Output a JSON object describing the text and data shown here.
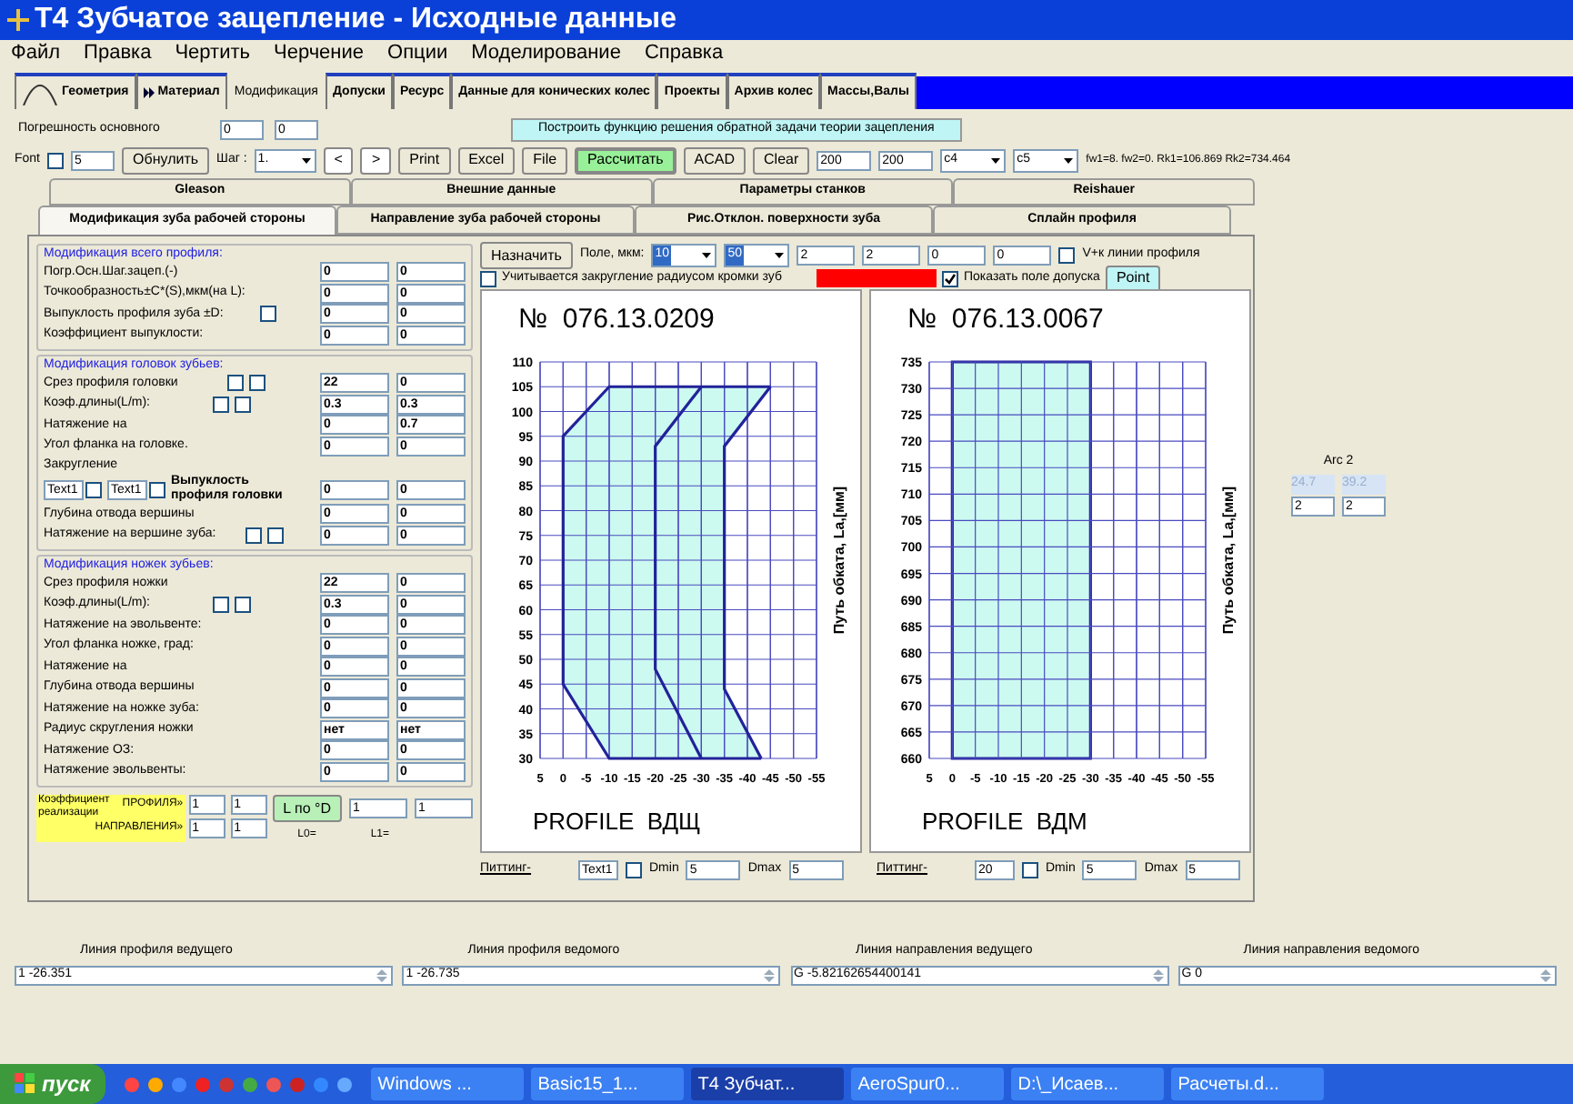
{
  "window": {
    "title": "T4 Зубчатое зацепление - Исходные данные"
  },
  "menu": [
    "Файл",
    "Правка",
    "Чертить",
    "Черчение",
    "Опции",
    "Моделирование",
    "Справка"
  ],
  "top_tabs": [
    {
      "label": "Геометрия",
      "selected": false,
      "kind": "arch"
    },
    {
      "label": "Материал",
      "selected": false,
      "kind": "arrow"
    },
    {
      "label": "Модификация",
      "selected": true,
      "kind": "plain"
    },
    {
      "label": "Допуски",
      "selected": false,
      "kind": "plain"
    },
    {
      "label": "Ресурс",
      "selected": false,
      "kind": "plain"
    },
    {
      "label": "Данные для конических колес",
      "selected": false,
      "kind": "plain"
    },
    {
      "label": "Проекты",
      "selected": false,
      "kind": "plain"
    },
    {
      "label": "Архив колес",
      "selected": false,
      "kind": "plain"
    },
    {
      "label": "Массы,Валы",
      "selected": false,
      "kind": "plain"
    }
  ],
  "toolbar": {
    "error_label": "Погрешность основного",
    "error_values": [
      "0",
      "0"
    ],
    "solve_button": "Построить функцию решения обратной задачи теории зацепления",
    "font_label": "Font",
    "font_checked": false,
    "font_value": "5",
    "reset_button": "Обнулить",
    "step_label": "Шаг :",
    "step_value": "1.",
    "prev_button": "<",
    "next_button": ">",
    "buttons": [
      {
        "label": "Print",
        "kind": "plain"
      },
      {
        "label": "Excel",
        "kind": "plain"
      },
      {
        "label": "File",
        "kind": "plain"
      },
      {
        "label": "Рассчитать",
        "kind": "primary"
      },
      {
        "label": "ACAD",
        "kind": "plain"
      },
      {
        "label": "Clear",
        "kind": "plain"
      }
    ],
    "values": [
      "200",
      "200"
    ],
    "selects": [
      "c4",
      "c5"
    ],
    "result": "fw1=8. fw2=0. Rk1=106.869 Rk2=734.464"
  },
  "tabs_back": [
    {
      "label": "Gleason",
      "selected": false
    },
    {
      "label": "Внешние данные",
      "selected": false
    },
    {
      "label": "Параметры станков",
      "selected": false
    },
    {
      "label": "Reishauer",
      "selected": false
    }
  ],
  "tabs_front": [
    {
      "label": "Модификация зуба рабочей стороны",
      "selected": true
    },
    {
      "label": "Направление зуба рабочей стороны",
      "selected": false
    },
    {
      "label": "Рис.Отклон. поверхности зуба",
      "selected": false
    },
    {
      "label": "Сплайн профиля",
      "selected": false
    }
  ],
  "groups": [
    {
      "title": "Модификация всего профиля:",
      "rows": [
        {
          "kind": "field",
          "label": "Погр.Осн.Шаг.зацеп.(-)",
          "values": [
            "0",
            "0"
          ]
        },
        {
          "kind": "field",
          "label": "Точкообразность±C*(S),мкм(на L):",
          "values": [
            "0",
            "0"
          ]
        },
        {
          "kind": "field",
          "label": "Выпуклость профиля зуба ±D:",
          "checks": [
            false
          ],
          "values": [
            "0",
            "0"
          ]
        },
        {
          "kind": "field",
          "label": "Коэффициент выпуклости:",
          "values": [
            "0",
            "0"
          ]
        }
      ]
    },
    {
      "title": "Модификация головок зубьев:",
      "rows": [
        {
          "kind": "field",
          "label": "Срез профиля головки",
          "checks": [
            false,
            false
          ],
          "values": [
            "22",
            "0"
          ]
        },
        {
          "kind": "field",
          "label": "Коэф.длины(L/m):",
          "checks": [
            false,
            false
          ],
          "values": [
            "0.3",
            "0.3"
          ]
        },
        {
          "kind": "field",
          "label": "Натяжение на",
          "values": [
            "0",
            "0.7"
          ]
        },
        {
          "kind": "field",
          "label": "Угол фланка на головке.",
          "values": [
            "0",
            "0"
          ]
        },
        {
          "kind": "rounding",
          "label": "Закругление",
          "texts": [
            {
              "value": "Text1",
              "checked": false
            },
            {
              "value": "Text1",
              "checked": false
            }
          ],
          "bold_label": "Выпуклость профиля головки",
          "values": [
            "0",
            "0"
          ]
        },
        {
          "kind": "field",
          "label": "Глубина отвода вершины",
          "values": [
            "0",
            "0"
          ]
        },
        {
          "kind": "field",
          "label": "Натяжение на вершине зуба:",
          "checks": [
            false,
            false
          ],
          "values": [
            "0",
            "0"
          ]
        }
      ]
    },
    {
      "title": "Модификация ножек зубьев:",
      "rows": [
        {
          "kind": "field",
          "label": "Срез профиля ножки",
          "values": [
            "22",
            "0"
          ]
        },
        {
          "kind": "field",
          "label": "Коэф.длины(L/m):",
          "checks": [
            false,
            false
          ],
          "values": [
            "0.3",
            "0"
          ]
        },
        {
          "kind": "field",
          "label": "Натяжение на эвольвенте:",
          "values": [
            "0",
            "0"
          ]
        },
        {
          "kind": "field",
          "label": "Угол фланка ножке, град:",
          "values": [
            "0",
            "0"
          ]
        },
        {
          "kind": "field",
          "label": "Натяжение на",
          "values": [
            "0",
            "0"
          ]
        },
        {
          "kind": "field",
          "label": "Глубина отвода вершины",
          "values": [
            "0",
            "0"
          ]
        },
        {
          "kind": "field",
          "label": "Натяжение на ножке зуба:",
          "values": [
            "0",
            "0"
          ]
        },
        {
          "kind": "field",
          "label": "Радиус скругления ножки",
          "values": [
            "нет",
            "нет"
          ]
        },
        {
          "kind": "field",
          "label": "Натяжение ОЗ:",
          "values": [
            "0",
            "0"
          ]
        },
        {
          "kind": "field",
          "label": "Натяжение эвольвенты:",
          "values": [
            "0",
            "0"
          ]
        }
      ]
    }
  ],
  "coefficient": {
    "title": "Коэффициент реализации",
    "rows": [
      {
        "label": "ПРОФИЛЯ»",
        "values": [
          "1",
          "1"
        ]
      },
      {
        "label": "НАПРАВЛЕНИЯ»",
        "values": [
          "1",
          "1"
        ]
      }
    ],
    "button": "L по °D",
    "l_values": [
      "1",
      "1"
    ],
    "l_labels": [
      "L0=",
      "L1="
    ]
  },
  "chart_controls": {
    "assign_button": "Назначить",
    "field_label": "Поле, мкм:",
    "field_selects": [
      "10",
      "50"
    ],
    "values": [
      "2",
      "2",
      "0",
      "0"
    ],
    "vplus": {
      "label": "V+к линии профиля",
      "checked": false
    },
    "rounding_check": {
      "label": "Учитывается закругление радиусом кромки зуб",
      "checked": false
    },
    "tolerance": {
      "label": "Показать поле допуска",
      "checked": true
    },
    "point_button": "Point"
  },
  "charts": [
    {
      "chart_data": {
        "type": "line",
        "title": "№  076.13.0209",
        "grid": true,
        "xlabel": "PROFILE  ВДЩ",
        "ylabel": "Путь обката, La,[мм]",
        "xlim": [
          5,
          -55
        ],
        "ylim": [
          30,
          110
        ],
        "xticks": [
          5,
          0,
          -5,
          -10,
          -15,
          -20,
          -25,
          -30,
          -35,
          -40,
          -45,
          -50,
          -55
        ],
        "yticks": [
          30,
          35,
          40,
          45,
          50,
          55,
          60,
          65,
          70,
          75,
          80,
          85,
          90,
          95,
          100,
          105,
          110
        ],
        "series": [
          {
            "color": "#22229a",
            "x": [
              -45,
              -10,
              0,
              0,
              -10,
              -43
            ],
            "values": [
              105,
              105,
              95,
              45,
              30,
              30
            ]
          },
          {
            "color": "#22229a",
            "x": [
              -45,
              -35,
              -35,
              -43
            ],
            "values": [
              105,
              93,
              44,
              30
            ]
          },
          {
            "color": "#22229a",
            "x": [
              -30,
              -20,
              -20,
              -30
            ],
            "values": [
              105,
              93,
              48,
              30
            ]
          }
        ]
      },
      "pitting": {
        "label": "Питтинг-",
        "value": "Text1",
        "checked": false,
        "dmin_label": "Dmin",
        "dmin": "5",
        "dmax_label": "Dmax",
        "dmax": "5"
      }
    },
    {
      "chart_data": {
        "type": "area",
        "title": "№  076.13.0067",
        "grid": true,
        "xlabel": "PROFILE  ВДМ",
        "ylabel": "Путь обката, La,[мм]",
        "xlim": [
          5,
          -55
        ],
        "ylim": [
          660,
          735
        ],
        "xticks": [
          5,
          0,
          -5,
          -10,
          -15,
          -20,
          -25,
          -30,
          -35,
          -40,
          -45,
          -50,
          -55
        ],
        "yticks": [
          660,
          665,
          670,
          675,
          680,
          685,
          690,
          695,
          700,
          705,
          710,
          715,
          720,
          725,
          730,
          735
        ],
        "series": [
          {
            "color": "#ccfaf0",
            "x": [
              0,
              0,
              -30,
              -30,
              0
            ],
            "values": [
              660,
              735,
              735,
              660,
              660
            ]
          }
        ]
      },
      "pitting": {
        "label": "Питтинг-",
        "value": "20",
        "checked": false,
        "dmin_label": "Dmin",
        "dmin": "5",
        "dmax_label": "Dmax",
        "dmax": "5"
      }
    }
  ],
  "arc": {
    "label": "Arc 2",
    "readings": [
      "24.7",
      "39.2"
    ],
    "values": [
      "2",
      "2"
    ]
  },
  "bottom_lines": [
    {
      "label": "Линия профиля ведущего",
      "value": "1 -26.351"
    },
    {
      "label": "Линия профиля ведомого",
      "value": "1 -26.735"
    },
    {
      "label": "Линия направления ведущего",
      "value": "G -5.82162654400141"
    },
    {
      "label": "Линия направления ведомого",
      "value": "G 0"
    }
  ],
  "taskbar": {
    "start": "пуск",
    "tasks": [
      {
        "label": "Windows ...",
        "selected": false
      },
      {
        "label": "Basic15_1...",
        "selected": false
      },
      {
        "label": "T4 Зубчат...",
        "selected": true
      },
      {
        "label": "AeroSpur0...",
        "selected": false
      },
      {
        "label": "D:\\_Исаев...",
        "selected": false
      },
      {
        "label": "Расчеты.d...",
        "selected": false
      }
    ]
  }
}
